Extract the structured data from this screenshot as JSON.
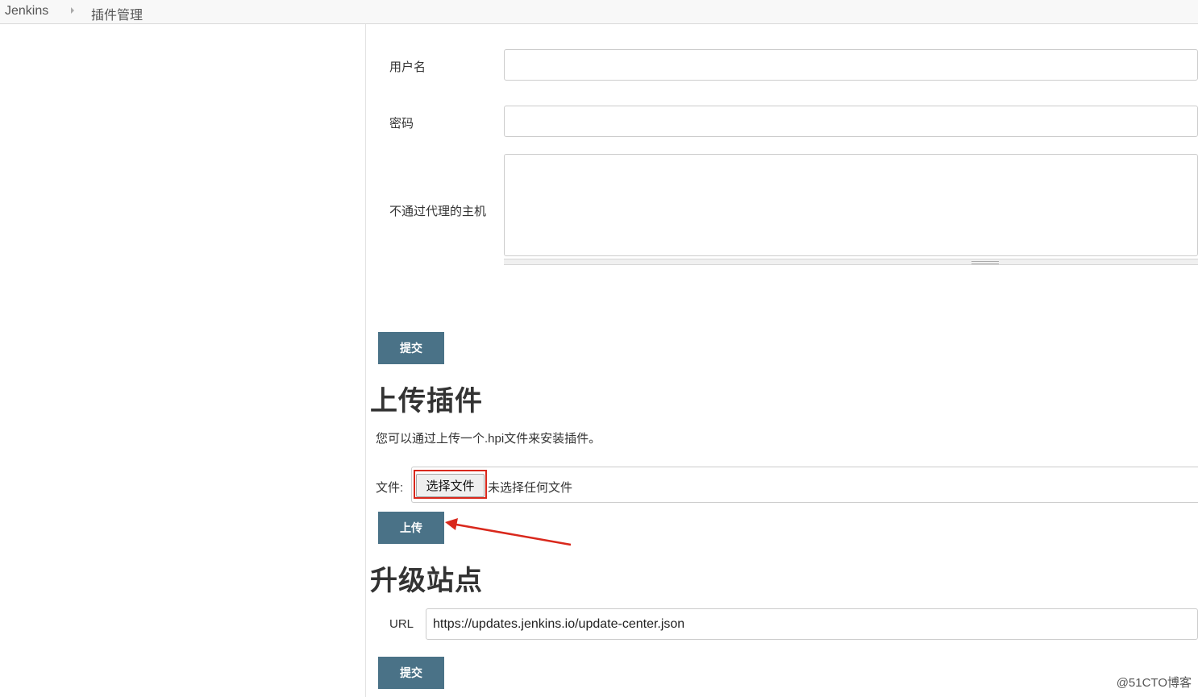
{
  "breadcrumb": {
    "home": "Jenkins",
    "current": "插件管理"
  },
  "proxy_form": {
    "username_label": "用户名",
    "password_label": "密码",
    "no_proxy_label": "不通过代理的主机",
    "submit_label": "提交"
  },
  "upload": {
    "title": "上传插件",
    "description": "您可以通过上传一个.hpi文件来安装插件。",
    "file_label": "文件:",
    "choose_button": "选择文件",
    "no_file_text": "未选择任何文件",
    "upload_button": "上传"
  },
  "update_site": {
    "title": "升级站点",
    "url_label": "URL",
    "url_value": "https://updates.jenkins.io/update-center.json",
    "submit_label": "提交"
  },
  "annotation": {
    "color": "#d9281c"
  },
  "colors": {
    "button": "#4a7287",
    "breadcrumb_bg": "#f8f8f8"
  },
  "watermark": "@51CTO博客"
}
